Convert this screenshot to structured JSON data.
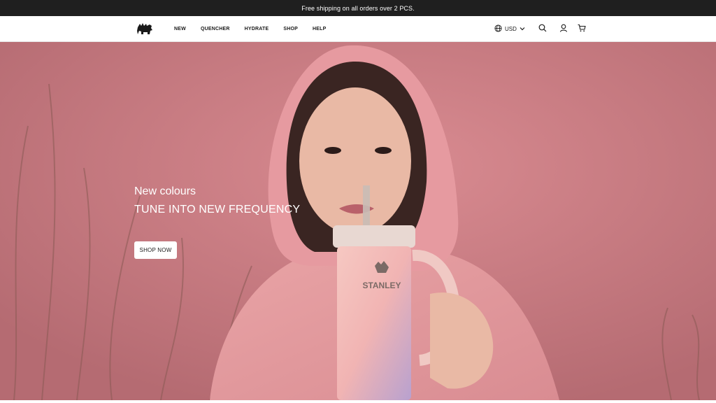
{
  "announcement": {
    "text": "Free shipping on all orders over 2 PCS."
  },
  "header": {
    "logo_icon": "bear-logo-icon",
    "nav": [
      {
        "label": "NEW"
      },
      {
        "label": "QUENCHER"
      },
      {
        "label": "HYDRATE"
      },
      {
        "label": "SHOP"
      },
      {
        "label": "HELP"
      }
    ],
    "currency": {
      "label": "USD",
      "icon": "globe-icon",
      "caret": "chevron-down-icon"
    },
    "icons": {
      "search": "search-icon",
      "account": "user-icon",
      "cart": "cart-icon"
    }
  },
  "hero": {
    "eyebrow": "New colours",
    "title": "TUNE INTO NEW FREQUENCY",
    "cta_label": "SHOP NOW",
    "product_brand": "STANLEY",
    "colors": {
      "background": "#c97a80",
      "hoodie": "#e7a0a3",
      "text": "#ffffff"
    }
  }
}
